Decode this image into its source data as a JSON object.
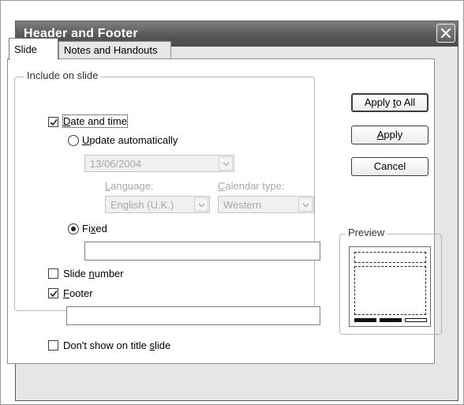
{
  "dialog": {
    "title": "Header and Footer"
  },
  "tabs": [
    {
      "label": "Slide",
      "active": true
    },
    {
      "label": "Notes and Handouts",
      "active": false
    }
  ],
  "include_group": {
    "label": "Include on slide"
  },
  "date_time": {
    "checked": true,
    "label_before": "",
    "label_accel": "D",
    "label_after": "ate and time",
    "update_auto": {
      "selected": false,
      "label_accel": "U",
      "label_after": "pdate automatically"
    },
    "date_value": "13/06/2004",
    "language": {
      "label_accel": "L",
      "label_after": "anguage:",
      "value": "English (U.K.)"
    },
    "calendar": {
      "label_accel": "C",
      "label_after": "alendar type:",
      "value": "Western"
    },
    "fixed": {
      "selected": true,
      "label_before": "Fi",
      "label_accel": "x",
      "label_after": "ed",
      "value": ""
    }
  },
  "slide_number": {
    "checked": false,
    "label_before": "Slide ",
    "label_accel": "n",
    "label_after": "umber"
  },
  "footer": {
    "checked": true,
    "label_accel": "F",
    "label_after": "ooter",
    "value": ""
  },
  "dont_show_title": {
    "checked": false,
    "label_before": "Don't show on title ",
    "label_accel": "s",
    "label_after": "lide"
  },
  "buttons": {
    "apply_all_before": "Apply ",
    "apply_all_accel": "t",
    "apply_all_after": "o All",
    "apply_accel": "A",
    "apply_after": "pply",
    "cancel": "Cancel"
  },
  "preview": {
    "label": "Preview"
  },
  "icons": {
    "close": "close-icon",
    "check": "check-icon",
    "dropdown": "chevron-down-icon"
  },
  "colors": {
    "title_bar": "#5e5e5e",
    "dialog_bg": "#e6e6e6",
    "panel_bg": "#ffffff"
  }
}
